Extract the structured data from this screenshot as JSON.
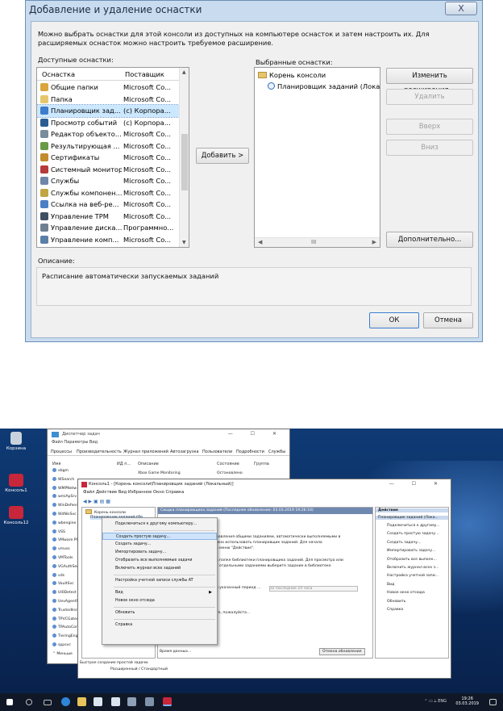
{
  "dialog": {
    "title": "Добавление и удаление оснастки",
    "close_glyph": "X",
    "intro": "Можно выбрать оснастки для этой консоли из доступных на компьютере оснасток и затем настроить их. Для расширяемых оснасток можно настроить требуемое расширение.",
    "available_label": "Доступные оснастки:",
    "selected_label": "Выбранные оснастки:",
    "col_snapin": "Оснастка",
    "col_vendor": "Поставщик",
    "available": [
      {
        "name": "Общие папки",
        "vendor": "Microsoft Co...",
        "color": "#d9a53c"
      },
      {
        "name": "Папка",
        "vendor": "Microsoft Co...",
        "color": "#e6c66d"
      },
      {
        "name": "Планировщик зад...",
        "vendor": "(c) Корпора...",
        "color": "#3d7ccb"
      },
      {
        "name": "Просмотр событий",
        "vendor": "(c) Корпора...",
        "color": "#2b5d94"
      },
      {
        "name": "Редактор объекто...",
        "vendor": "Microsoft Co...",
        "color": "#7a8b9c"
      },
      {
        "name": "Результирующая ...",
        "vendor": "Microsoft Co...",
        "color": "#6a9a45"
      },
      {
        "name": "Сертификаты",
        "vendor": "Microsoft Co...",
        "color": "#c28b2c"
      },
      {
        "name": "Системный монитор",
        "vendor": "Microsoft Co...",
        "color": "#b53b3b"
      },
      {
        "name": "Службы",
        "vendor": "Microsoft Co...",
        "color": "#6e86a8"
      },
      {
        "name": "Службы компонен...",
        "vendor": "Microsoft Co...",
        "color": "#c0a544"
      },
      {
        "name": "Ссылка на веб-ре...",
        "vendor": "Microsoft Co...",
        "color": "#4b7fc4"
      },
      {
        "name": "Управление TPM",
        "vendor": "Microsoft Co...",
        "color": "#3f4f63"
      },
      {
        "name": "Управление диска...",
        "vendor": "Программно...",
        "color": "#6f7f92"
      },
      {
        "name": "Управление комп...",
        "vendor": "Microsoft Co...",
        "color": "#5b7ea6"
      }
    ],
    "selected_root": "Корень консоли",
    "selected_child": "Планировщик заданий (Локаль",
    "btn_add": "Добавить >",
    "btn_edit_ext": "Изменить расширения...",
    "btn_remove": "Удалить",
    "btn_up": "Вверх",
    "btn_down": "Вниз",
    "btn_advanced": "Дополнительно...",
    "description_label": "Описание:",
    "description_text": "Расписание автоматически запускаемых заданий",
    "btn_ok": "ОК",
    "btn_cancel": "Отмена",
    "hscroll_glyph": "III"
  },
  "desktop": {
    "icons": [
      {
        "label": "Корзина"
      },
      {
        "label": "Консоль1"
      },
      {
        "label": "Консоль12"
      }
    ],
    "taskmgr": {
      "title": "Диспетчер задач",
      "menu": "Файл   Параметры   Вид",
      "tabs": [
        "Процессы",
        "Производительность",
        "Журнал приложений",
        "Автозагрузка",
        "Пользователи",
        "Подробности",
        "Службы"
      ],
      "cols": [
        "Имя",
        "ИД п...",
        "Описание",
        "Состояние",
        "Группа"
      ],
      "rows": [
        "xbgm",
        "WSearch",
        "WMPNetw",
        "wmiApSrv",
        "WinDefend",
        "WdNisSvc",
        "wbengine",
        "VSS",
        "VMware Ph",
        "vmvss",
        "VMTools",
        "VGAuthSer",
        "vds",
        "VaultSvc",
        "UI0Detect",
        "UevAgentS",
        "TrustedInst",
        "TPVCGatew",
        "TPAutoCon",
        "TieringEng",
        "sppsvc"
      ],
      "first_desc": "Xbox Game Monitoring",
      "first_state": "Остановлено",
      "less": "Меньше"
    },
    "mmc": {
      "title": "Консоль1 - [Корень консоли\\Планировщик заданий (Локальный)]",
      "menu": "Файл   Действие   Вид   Избранное   Окно   Справка",
      "tree_root": "Корень консоли",
      "tree_child": "Планировщик заданий (Ло",
      "center_head": "Сводка планировщика заданий (Последнее обновление: 03.03.2019 19:26:10)",
      "center_lines": [
        "равления общими заданиями, автоматически выполняемыми в",
        "жно использовать планировщик заданий. Для начала",
        "в меню \"Действие\".",
        "в папке библиотеки планировщика заданий. Для просмотра или",
        "с отдельными заданиями выберите задание в библиотеке",
        "в указанный период ...",
        "за последние 24 часа",
        "те, пожалуйста..."
      ],
      "last_update": "Время данных...",
      "refresh_btn": "Отмена обновления",
      "status": "Быстрое создание простой задачи.",
      "tabs": "Расширенный / Стандартный",
      "actions_head": "Действия",
      "actions_sub": "Планировщик заданий (Лока...",
      "actions": [
        "Подключиться к другому...",
        "Создать простую задачу...",
        "Создать задачу...",
        "Импортировать задачу...",
        "Отобразить все выполн...",
        "Включить журнал всех з...",
        "Настройка учетной запи...",
        "Вид",
        "Новое окно отсюда",
        "Обновить",
        "Справка"
      ]
    },
    "context_menu": [
      {
        "label": "Подключиться к другому компьютеру..."
      },
      {
        "label": "Создать простую задачу...",
        "highlight": true
      },
      {
        "label": "Создать задачу..."
      },
      {
        "label": "Импортировать задачу..."
      },
      {
        "label": "Отобразить все выполняемые задачи"
      },
      {
        "label": "Включить журнал всех заданий"
      },
      {
        "label": "Настройка учетной записи службы AT"
      },
      {
        "label": "Вид"
      },
      {
        "label": "Новое окно отсюда"
      },
      {
        "label": "Обновить"
      },
      {
        "label": "Справка"
      }
    ],
    "taskbar": {
      "lang": "ENG",
      "time": "19:26",
      "date": "03.03.2019"
    }
  }
}
